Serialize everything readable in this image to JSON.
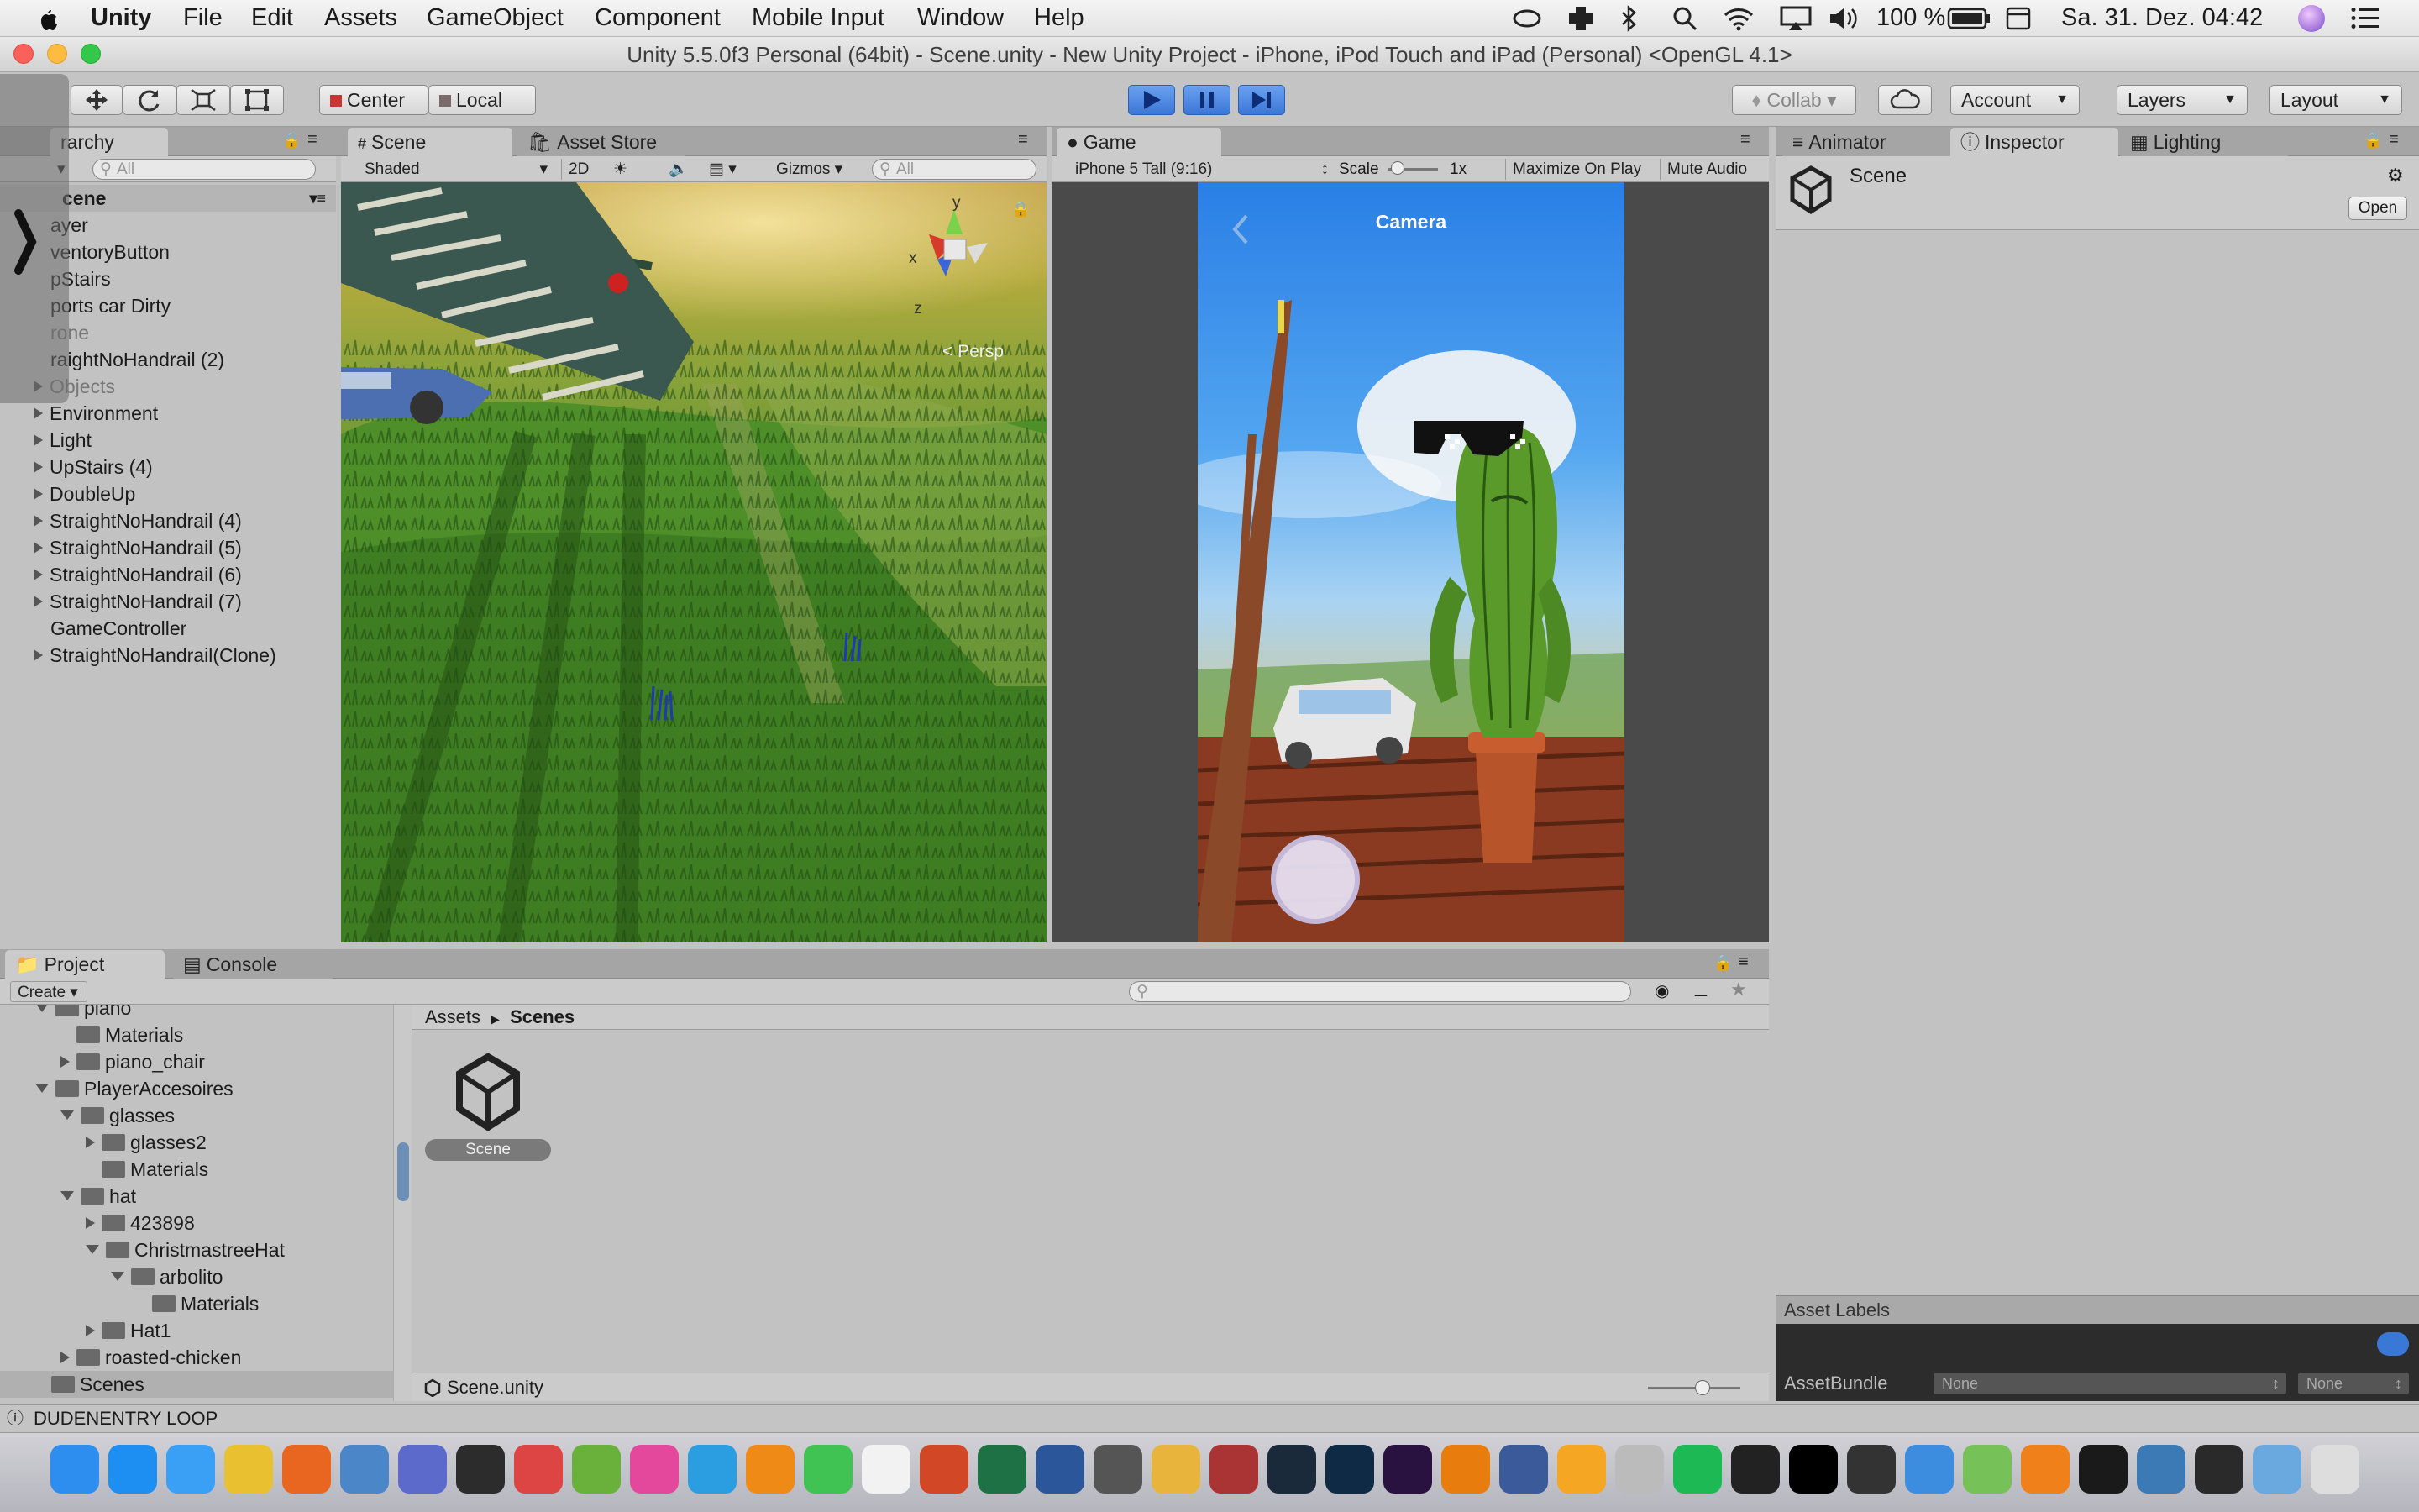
{
  "menubar": {
    "apple": "",
    "app_name": "Unity",
    "items": [
      "File",
      "Edit",
      "Assets",
      "GameObject",
      "Component",
      "Mobile Input",
      "Window",
      "Help"
    ],
    "battery": "100 %",
    "clock": "Sa. 31. Dez.  04:42"
  },
  "window": {
    "title": "Unity 5.5.0f3 Personal (64bit) - Scene.unity - New Unity Project - iPhone, iPod Touch and iPad (Personal) <OpenGL 4.1>"
  },
  "toolbar": {
    "pivot_label": "Center",
    "space_label": "Local",
    "collab_label": "Collab",
    "account_label": "Account",
    "layers_label": "Layers",
    "layout_label": "Layout"
  },
  "hierarchy": {
    "tab_label": "rarchy",
    "search_placeholder": "All",
    "scene_name": "cene",
    "items": [
      {
        "label": "ayer",
        "expandable": false
      },
      {
        "label": "ventoryButton",
        "expandable": false
      },
      {
        "label": "pStairs",
        "expandable": false
      },
      {
        "label": "ports car Dirty",
        "expandable": false
      },
      {
        "label": "rone",
        "expandable": false,
        "dim": true
      },
      {
        "label": "raightNoHandrail (2)",
        "expandable": false
      },
      {
        "label": "Objects",
        "expandable": true,
        "dim": true
      },
      {
        "label": "Environment",
        "expandable": true
      },
      {
        "label": "Light",
        "expandable": true
      },
      {
        "label": "UpStairs (4)",
        "expandable": true
      },
      {
        "label": "DoubleUp",
        "expandable": true
      },
      {
        "label": "StraightNoHandrail (4)",
        "expandable": true
      },
      {
        "label": "StraightNoHandrail (5)",
        "expandable": true
      },
      {
        "label": "StraightNoHandrail (6)",
        "expandable": true
      },
      {
        "label": "StraightNoHandrail (7)",
        "expandable": true
      },
      {
        "label": "GameController",
        "expandable": false
      },
      {
        "label": "StraightNoHandrail(Clone)",
        "expandable": true
      }
    ]
  },
  "scene_view": {
    "tab_scene": "Scene",
    "tab_asset_store": "Asset Store",
    "shading_mode": "Shaded",
    "mode_2d": "2D",
    "gizmos_label": "Gizmos",
    "search_placeholder": "All",
    "persp_label": "Persp",
    "axis_y": "y",
    "axis_x": "x",
    "axis_z": "z"
  },
  "game_view": {
    "tab_label": "Game",
    "resolution": "iPhone 5 Tall (9:16)",
    "scale_label": "Scale",
    "scale_value": "1x",
    "maximize_label": "Maximize On Play",
    "mute_label": "Mute Audio",
    "camera_label": "Camera"
  },
  "inspector": {
    "tab_animator": "Animator",
    "tab_inspector": "Inspector",
    "tab_lighting": "Lighting",
    "asset_name": "Scene",
    "open_button": "Open",
    "asset_labels": "Asset Labels",
    "assetbundle_label": "AssetBundle",
    "assetbundle_value": "None",
    "variant_value": "None"
  },
  "project": {
    "tab_project": "Project",
    "tab_console": "Console",
    "create_label": "Create",
    "tree": [
      {
        "label": "piano",
        "indent": 1,
        "state": "open"
      },
      {
        "label": "Materials",
        "indent": 2,
        "state": "none"
      },
      {
        "label": "piano_chair",
        "indent": 2,
        "state": "closed"
      },
      {
        "label": "PlayerAccesoires",
        "indent": 1,
        "state": "open"
      },
      {
        "label": "glasses",
        "indent": 2,
        "state": "open"
      },
      {
        "label": "glasses2",
        "indent": 3,
        "state": "closed"
      },
      {
        "label": "Materials",
        "indent": 3,
        "state": "none"
      },
      {
        "label": "hat",
        "indent": 2,
        "state": "open"
      },
      {
        "label": "423898",
        "indent": 3,
        "state": "closed"
      },
      {
        "label": "ChristmastreeHat",
        "indent": 3,
        "state": "open"
      },
      {
        "label": "arbolito",
        "indent": 4,
        "state": "open"
      },
      {
        "label": "Materials",
        "indent": 5,
        "state": "none"
      },
      {
        "label": "Hat1",
        "indent": 3,
        "state": "closed"
      },
      {
        "label": "roasted-chicken",
        "indent": 2,
        "state": "closed"
      },
      {
        "label": "Scenes",
        "indent": 1,
        "state": "none",
        "selected": true
      }
    ],
    "breadcrumb_root": "Assets",
    "breadcrumb_current": "Scenes",
    "asset_item": "Scene",
    "footer_path": "Scene.unity"
  },
  "statusbar": {
    "message": "DUDENENTRY LOOP"
  },
  "dock": {
    "apps": [
      {
        "name": "finder",
        "color": "#2d8ef0"
      },
      {
        "name": "app-store",
        "color": "#1e8ff2"
      },
      {
        "name": "safari",
        "color": "#3aa0f5"
      },
      {
        "name": "chrome",
        "color": "#e8c030"
      },
      {
        "name": "firefox",
        "color": "#e8661f"
      },
      {
        "name": "mail",
        "color": "#4a86c8"
      },
      {
        "name": "launchpad",
        "color": "#5c6acb"
      },
      {
        "name": "simplenote",
        "color": "#2c2c2c"
      },
      {
        "name": "tools",
        "color": "#d44"
      },
      {
        "name": "utorrent",
        "color": "#6ab13b"
      },
      {
        "name": "itunes",
        "color": "#e4489c"
      },
      {
        "name": "sync",
        "color": "#2a9ee0"
      },
      {
        "name": "vlc",
        "color": "#f08a16"
      },
      {
        "name": "messages",
        "color": "#40c352"
      },
      {
        "name": "calendar",
        "color": "#f2f2f2"
      },
      {
        "name": "powerpoint",
        "color": "#d24726"
      },
      {
        "name": "excel",
        "color": "#1e7145"
      },
      {
        "name": "word",
        "color": "#2b579a"
      },
      {
        "name": "evernote",
        "color": "#555"
      },
      {
        "name": "photos",
        "color": "#e9b43b"
      },
      {
        "name": "photo-booth",
        "color": "#a33"
      },
      {
        "name": "lightroom",
        "color": "#1a2a3a"
      },
      {
        "name": "photoshop",
        "color": "#0f2a44"
      },
      {
        "name": "premiere",
        "color": "#2a1240"
      },
      {
        "name": "blender",
        "color": "#e87d0d"
      },
      {
        "name": "music",
        "color": "#3a5a9a"
      },
      {
        "name": "fl-studio",
        "color": "#f5a623"
      },
      {
        "name": "sequel",
        "color": "#bbb"
      },
      {
        "name": "spotify",
        "color": "#1db954"
      },
      {
        "name": "unity",
        "color": "#222"
      },
      {
        "name": "intellij",
        "color": "#000"
      },
      {
        "name": "github",
        "color": "#333"
      },
      {
        "name": "xcode",
        "color": "#3c8de0"
      },
      {
        "name": "android-studio",
        "color": "#77c159"
      },
      {
        "name": "sublime",
        "color": "#f08019"
      },
      {
        "name": "terminal",
        "color": "#1a1a1a"
      },
      {
        "name": "network",
        "color": "#3c7ab5"
      },
      {
        "name": "activity-monitor",
        "color": "#2a2a2a"
      },
      {
        "name": "folder",
        "color": "#6aa8e0"
      },
      {
        "name": "trash",
        "color": "#ddd"
      }
    ]
  }
}
